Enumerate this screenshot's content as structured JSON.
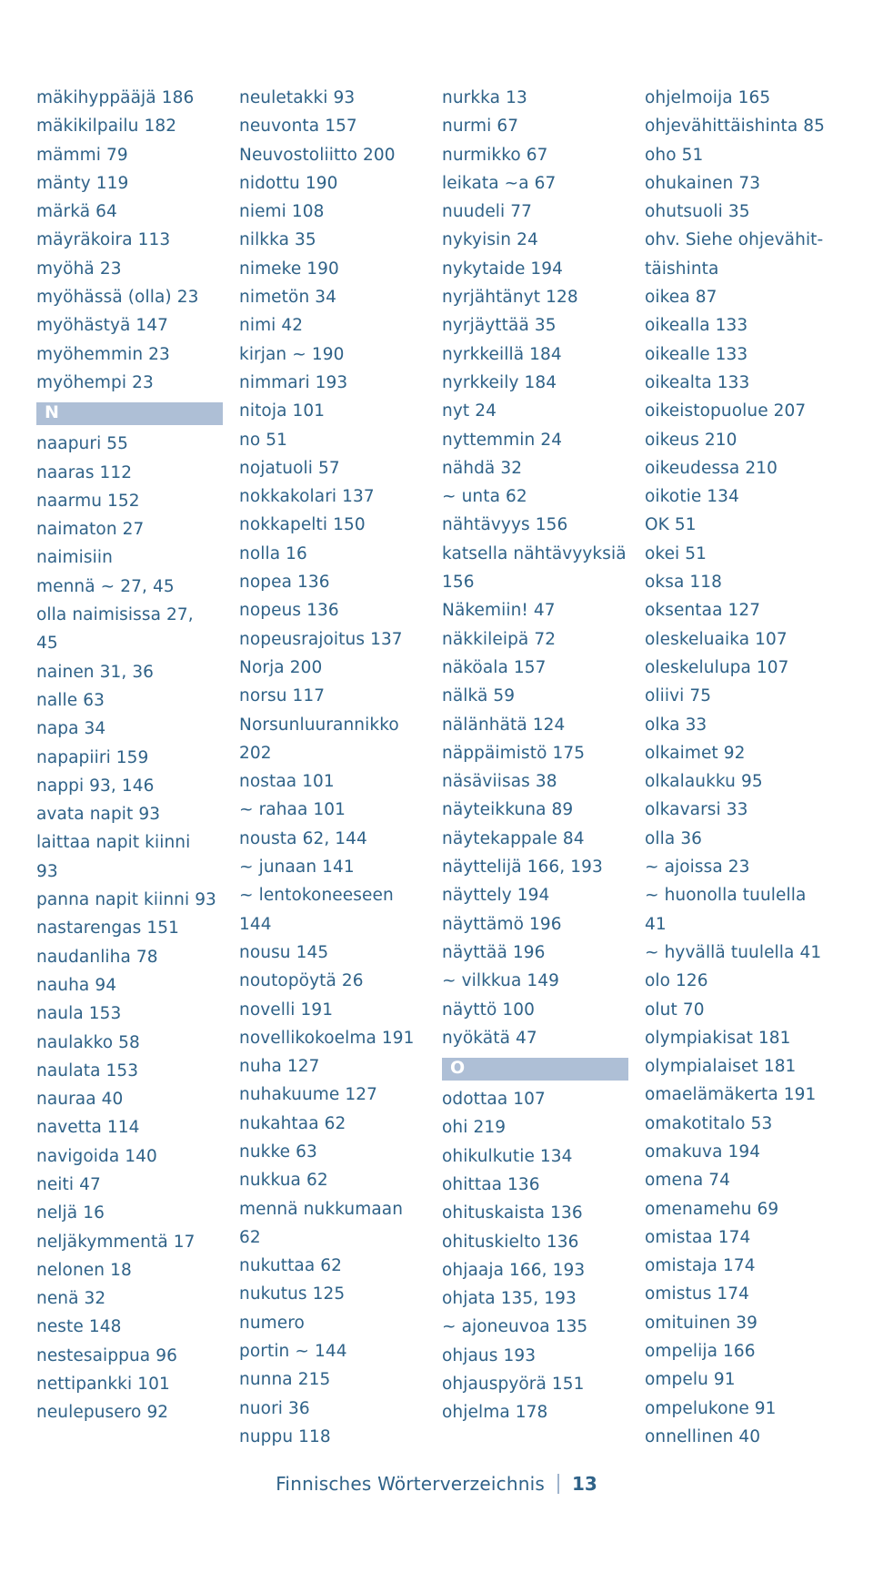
{
  "document": {
    "footer_text": "Finnisches Wörterverzeichnis",
    "page_number": "13",
    "band_color": "#aebfd6",
    "text_color": "#2f6288"
  },
  "columns": [
    {
      "id": "column-1",
      "entries": [
        {
          "text": "mäkihyppääjä 186",
          "indent": 0
        },
        {
          "text": "mäkikilpailu 182",
          "indent": 0
        },
        {
          "text": "mämmi 79",
          "indent": 0
        },
        {
          "text": "mänty 119",
          "indent": 0
        },
        {
          "text": "märkä 64",
          "indent": 0
        },
        {
          "text": "mäyräkoira 113",
          "indent": 0
        },
        {
          "text": "myöhä 23",
          "indent": 0
        },
        {
          "text": "myöhässä (olla) 23",
          "indent": 0
        },
        {
          "text": "myöhästyä 147",
          "indent": 0
        },
        {
          "text": "myöhemmin 23",
          "indent": 0
        },
        {
          "text": "myöhempi 23",
          "indent": 0
        },
        {
          "band": "N"
        },
        {
          "text": "naapuri 55",
          "indent": 0
        },
        {
          "text": "naaras 112",
          "indent": 0
        },
        {
          "text": "naarmu 152",
          "indent": 0
        },
        {
          "text": "naimaton 27",
          "indent": 0
        },
        {
          "text": "naimisiin",
          "indent": 0
        },
        {
          "text": "mennä ~ 27, 45",
          "indent": 1
        },
        {
          "text": "olla naimisissa 27,",
          "indent": 1
        },
        {
          "text": "45",
          "indent": 1
        },
        {
          "text": "nainen 31, 36",
          "indent": 0
        },
        {
          "text": "nalle 63",
          "indent": 0
        },
        {
          "text": "napa 34",
          "indent": 0
        },
        {
          "text": "napapiiri 159",
          "indent": 0
        },
        {
          "text": "nappi 93, 146",
          "indent": 0
        },
        {
          "text": "avata napit 93",
          "indent": 1
        },
        {
          "text": "laittaa napit kiinni",
          "indent": 1
        },
        {
          "text": "93",
          "indent": 1
        },
        {
          "text": "panna napit kiinni 93",
          "indent": 1
        },
        {
          "text": "nastarengas 151",
          "indent": 0
        },
        {
          "text": "naudanliha 78",
          "indent": 0
        },
        {
          "text": "nauha 94",
          "indent": 0
        },
        {
          "text": "naula 153",
          "indent": 0
        },
        {
          "text": "naulakko 58",
          "indent": 0
        },
        {
          "text": "naulata 153",
          "indent": 0
        },
        {
          "text": "nauraa 40",
          "indent": 0
        },
        {
          "text": "navetta 114",
          "indent": 0
        },
        {
          "text": "navigoida 140",
          "indent": 0
        },
        {
          "text": "neiti 47",
          "indent": 0
        },
        {
          "text": "neljä 16",
          "indent": 0
        },
        {
          "text": "neljäkymmentä 17",
          "indent": 0
        },
        {
          "text": "nelonen 18",
          "indent": 0
        },
        {
          "text": "nenä 32",
          "indent": 0
        },
        {
          "text": "neste 148",
          "indent": 0
        },
        {
          "text": "nestesaippua 96",
          "indent": 0
        },
        {
          "text": "nettipankki 101",
          "indent": 0
        },
        {
          "text": "neulepusero 92",
          "indent": 0
        }
      ]
    },
    {
      "id": "column-2",
      "entries": [
        {
          "text": "neuletakki 93",
          "indent": 0
        },
        {
          "text": "neuvonta 157",
          "indent": 0
        },
        {
          "text": "Neuvostoliitto 200",
          "indent": 0
        },
        {
          "text": "nidottu 190",
          "indent": 0
        },
        {
          "text": "niemi 108",
          "indent": 0
        },
        {
          "text": "nilkka 35",
          "indent": 0
        },
        {
          "text": "nimeke 190",
          "indent": 0
        },
        {
          "text": "nimetön 34",
          "indent": 0
        },
        {
          "text": "nimi 42",
          "indent": 0
        },
        {
          "text": "kirjan ~ 190",
          "indent": 1
        },
        {
          "text": "nimmari 193",
          "indent": 0
        },
        {
          "text": "nitoja 101",
          "indent": 0
        },
        {
          "text": "no 51",
          "indent": 0
        },
        {
          "text": "nojatuoli 57",
          "indent": 0
        },
        {
          "text": "nokkakolari 137",
          "indent": 0
        },
        {
          "text": "nokkapelti 150",
          "indent": 0
        },
        {
          "text": "nolla 16",
          "indent": 0
        },
        {
          "text": "nopea 136",
          "indent": 0
        },
        {
          "text": "nopeus 136",
          "indent": 0
        },
        {
          "text": "nopeusrajoitus 137",
          "indent": 0
        },
        {
          "text": "Norja 200",
          "indent": 0
        },
        {
          "text": "norsu 117",
          "indent": 0
        },
        {
          "text": "Norsunluurannikko",
          "indent": 0
        },
        {
          "text": "202",
          "indent": 1
        },
        {
          "text": "nostaa 101",
          "indent": 0
        },
        {
          "text": "~ rahaa 101",
          "indent": 1
        },
        {
          "text": "nousta 62, 144",
          "indent": 0
        },
        {
          "text": "~ junaan 141",
          "indent": 1
        },
        {
          "text": "~ lentokoneeseen",
          "indent": 1
        },
        {
          "text": "144",
          "indent": 1
        },
        {
          "text": "nousu 145",
          "indent": 0
        },
        {
          "text": "noutopöytä 26",
          "indent": 0
        },
        {
          "text": "novelli 191",
          "indent": 0
        },
        {
          "text": "novellikokoelma 191",
          "indent": 0
        },
        {
          "text": "nuha 127",
          "indent": 0
        },
        {
          "text": "nuhakuume 127",
          "indent": 0
        },
        {
          "text": "nukahtaa 62",
          "indent": 0
        },
        {
          "text": "nukke 63",
          "indent": 0
        },
        {
          "text": "nukkua 62",
          "indent": 0
        },
        {
          "text": "mennä nukkumaan",
          "indent": 1
        },
        {
          "text": "62",
          "indent": 1
        },
        {
          "text": "nukuttaa 62",
          "indent": 0
        },
        {
          "text": "nukutus 125",
          "indent": 0
        },
        {
          "text": "numero",
          "indent": 0
        },
        {
          "text": "portin ~ 144",
          "indent": 1
        },
        {
          "text": "nunna 215",
          "indent": 0
        },
        {
          "text": "nuori 36",
          "indent": 0
        },
        {
          "text": "nuppu 118",
          "indent": 0
        }
      ]
    },
    {
      "id": "column-3",
      "entries": [
        {
          "text": "nurkka 13",
          "indent": 0
        },
        {
          "text": "nurmi 67",
          "indent": 0
        },
        {
          "text": "nurmikko 67",
          "indent": 0
        },
        {
          "text": "leikata ~a 67",
          "indent": 1
        },
        {
          "text": "nuudeli 77",
          "indent": 0
        },
        {
          "text": "nykyisin 24",
          "indent": 0
        },
        {
          "text": "nykytaide 194",
          "indent": 0
        },
        {
          "text": "nyrjähtänyt 128",
          "indent": 0
        },
        {
          "text": "nyrjäyttää 35",
          "indent": 0
        },
        {
          "text": "nyrkkeillä 184",
          "indent": 0
        },
        {
          "text": "nyrkkeily 184",
          "indent": 0
        },
        {
          "text": "nyt 24",
          "indent": 0
        },
        {
          "text": "nyttemmin 24",
          "indent": 0
        },
        {
          "text": "nähdä 32",
          "indent": 0
        },
        {
          "text": "~ unta 62",
          "indent": 1
        },
        {
          "text": "nähtävyys 156",
          "indent": 0
        },
        {
          "text": "katsella nähtävyyksiä",
          "indent": 1
        },
        {
          "text": "156",
          "indent": 1
        },
        {
          "text": "Näkemiin! 47",
          "indent": 0
        },
        {
          "text": "näkkileipä 72",
          "indent": 0
        },
        {
          "text": "näköala 157",
          "indent": 0
        },
        {
          "text": "nälkä 59",
          "indent": 0
        },
        {
          "text": "nälänhätä 124",
          "indent": 0
        },
        {
          "text": "näppäimistö 175",
          "indent": 0
        },
        {
          "text": "näsäviisas 38",
          "indent": 0
        },
        {
          "text": "näyteikkuna 89",
          "indent": 0
        },
        {
          "text": "näytekappale 84",
          "indent": 0
        },
        {
          "text": "näyttelijä 166, 193",
          "indent": 0
        },
        {
          "text": "näyttely 194",
          "indent": 0
        },
        {
          "text": "näyttämö 196",
          "indent": 0
        },
        {
          "text": "näyttää 196",
          "indent": 0
        },
        {
          "text": "~ vilkkua 149",
          "indent": 1
        },
        {
          "text": "näyttö 100",
          "indent": 0
        },
        {
          "text": "nyökätä 47",
          "indent": 0
        },
        {
          "band": "O"
        },
        {
          "text": "odottaa 107",
          "indent": 0
        },
        {
          "text": "ohi 219",
          "indent": 0
        },
        {
          "text": "ohikulkutie 134",
          "indent": 0
        },
        {
          "text": "ohittaa 136",
          "indent": 0
        },
        {
          "text": "ohituskaista 136",
          "indent": 0
        },
        {
          "text": "ohituskielto 136",
          "indent": 0
        },
        {
          "text": "ohjaaja 166, 193",
          "indent": 0
        },
        {
          "text": "ohjata 135, 193",
          "indent": 0
        },
        {
          "text": "~ ajoneuvoa 135",
          "indent": 1
        },
        {
          "text": "ohjaus 193",
          "indent": 0
        },
        {
          "text": "ohjauspyörä 151",
          "indent": 0
        },
        {
          "text": "ohjelma 178",
          "indent": 0
        }
      ]
    },
    {
      "id": "column-4",
      "entries": [
        {
          "text": "ohjelmoija 165",
          "indent": 0
        },
        {
          "text": "ohjevähittäishinta 85",
          "indent": 0
        },
        {
          "text": "oho 51",
          "indent": 0
        },
        {
          "text": "ohukainen 73",
          "indent": 0
        },
        {
          "text": "ohutsuoli 35",
          "indent": 0
        },
        {
          "text": "ohv. Siehe ohjevähit-",
          "indent": 0,
          "italic_prefix": "ohv. Siehe"
        },
        {
          "text": "täishinta",
          "indent": 1
        },
        {
          "text": "oikea 87",
          "indent": 0
        },
        {
          "text": "oikealla 133",
          "indent": 0
        },
        {
          "text": "oikealle 133",
          "indent": 0
        },
        {
          "text": "oikealta 133",
          "indent": 0
        },
        {
          "text": "oikeistopuolue 207",
          "indent": 0
        },
        {
          "text": "oikeus 210",
          "indent": 0
        },
        {
          "text": "oikeudessa 210",
          "indent": 0
        },
        {
          "text": "oikotie 134",
          "indent": 0
        },
        {
          "text": "OK 51",
          "indent": 0
        },
        {
          "text": "okei 51",
          "indent": 0
        },
        {
          "text": "oksa 118",
          "indent": 0
        },
        {
          "text": "oksentaa 127",
          "indent": 0
        },
        {
          "text": "oleskeluaika 107",
          "indent": 0
        },
        {
          "text": "oleskelulupa 107",
          "indent": 0
        },
        {
          "text": "oliivi 75",
          "indent": 0
        },
        {
          "text": "olka 33",
          "indent": 0
        },
        {
          "text": "olkaimet 92",
          "indent": 0
        },
        {
          "text": "olkalaukku 95",
          "indent": 0
        },
        {
          "text": "olkavarsi 33",
          "indent": 0
        },
        {
          "text": "olla 36",
          "indent": 0
        },
        {
          "text": "~ ajoissa 23",
          "indent": 1
        },
        {
          "text": "~ huonolla tuulella",
          "indent": 1
        },
        {
          "text": "41",
          "indent": 1
        },
        {
          "text": "~ hyvällä tuulella 41",
          "indent": 1
        },
        {
          "text": "olo 126",
          "indent": 0
        },
        {
          "text": "olut 70",
          "indent": 0
        },
        {
          "text": "olympiakisat 181",
          "indent": 0
        },
        {
          "text": "olympialaiset 181",
          "indent": 0
        },
        {
          "text": "omaelämäkerta 191",
          "indent": 0
        },
        {
          "text": "omakotitalo 53",
          "indent": 0
        },
        {
          "text": "omakuva 194",
          "indent": 0
        },
        {
          "text": "omena 74",
          "indent": 0
        },
        {
          "text": "omenamehu 69",
          "indent": 0
        },
        {
          "text": "omistaa 174",
          "indent": 0
        },
        {
          "text": "omistaja 174",
          "indent": 0
        },
        {
          "text": "omistus 174",
          "indent": 0
        },
        {
          "text": "omituinen 39",
          "indent": 0
        },
        {
          "text": "ompelija 166",
          "indent": 0
        },
        {
          "text": "ompelu 91",
          "indent": 0
        },
        {
          "text": "ompelukone 91",
          "indent": 0
        },
        {
          "text": "onnellinen 40",
          "indent": 0
        }
      ]
    }
  ]
}
